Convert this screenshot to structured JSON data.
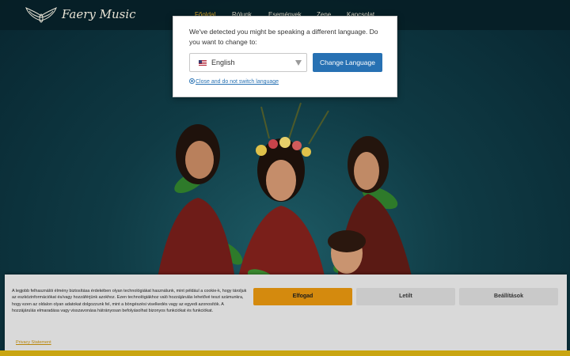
{
  "header": {
    "logo_text": "Faery Music",
    "nav": [
      "Főoldal",
      "Rólunk",
      "Események",
      "Zene",
      "Kapcsolat"
    ]
  },
  "language_popup": {
    "message": "We've detected you might be speaking a different language. Do you want to change to:",
    "selected_language": "English",
    "change_button": "Change Language",
    "close_link": "Close and do not switch language"
  },
  "cookie_banner": {
    "text": "A legjobb felhasználói élmény biztosítása érdekében olyan technológiákat használunk, mint például a cookie-k, hogy tároljuk az eszközinformációkat és/vagy hozzáférjünk azokhoz. Ezen technológiákhoz való hozzájárulás lehetővé teszi számunkra, hogy ezen az oldalon olyan adatokat dolgozzunk fel, mint a böngészési viselkedés vagy az egyedi azonosítók. A hozzájárulás elmaradása vagy visszavonása hátrányosan befolyásolhat bizonyos funkciókat és funkciókat.",
    "accept": "Elfogad",
    "deny": "Letilt",
    "settings": "Beállítások",
    "privacy": "Privacy Statement"
  },
  "colors": {
    "accent": "#d48a0e",
    "link_blue": "#2771b3",
    "nav_active": "#d6a52a"
  }
}
